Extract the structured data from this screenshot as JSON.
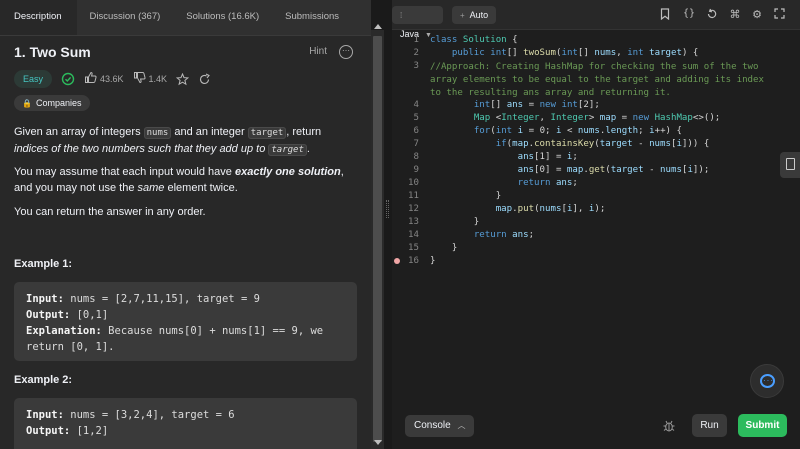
{
  "tabs": [
    {
      "label": "Description",
      "active": true
    },
    {
      "label": "Discussion (367)"
    },
    {
      "label": "Solutions (16.6K)"
    },
    {
      "label": "Submissions"
    }
  ],
  "problem": {
    "title": "1. Two Sum",
    "hint_label": "Hint",
    "difficulty": "Easy",
    "likes": "43.6K",
    "dislikes": "1.4K",
    "companies_label": "Companies"
  },
  "description": {
    "p1_a": "Given an array of integers ",
    "p1_code1": "nums",
    "p1_b": " and an integer ",
    "p1_code2": "target",
    "p1_c": ", return ",
    "p1_it": "indices of the two numbers such that they add up to ",
    "p1_code3": "target",
    "p1_d": ".",
    "p2_a": "You may assume that each input would have ",
    "p2_bi": "exactly one solution",
    "p2_b": ", and you may not use the ",
    "p2_it": "same",
    "p2_c": " element twice.",
    "p3": "You can return the answer in any order."
  },
  "examples": [
    {
      "title": "Example 1:",
      "input_label": "Input:",
      "input": " nums = [2,7,11,15], target = 9",
      "output_label": "Output:",
      "output": " [0,1]",
      "explanation_label": "Explanation:",
      "explanation": " Because nums[0] + nums[1] == 9, we return [0, 1]."
    },
    {
      "title": "Example 2:",
      "input_label": "Input:",
      "input": " nums = [3,2,4], target = 6",
      "output_label": "Output:",
      "output": " [1,2]"
    }
  ],
  "editor": {
    "language": "Java",
    "mode": "Auto",
    "line_numbers": [
      "1",
      "2",
      "3",
      "4",
      "5",
      "6",
      "7",
      "8",
      "9",
      "10",
      "11",
      "12",
      "13",
      "14",
      "15",
      "16"
    ],
    "breakpoint_line": "16"
  },
  "bottom": {
    "console_label": "Console",
    "run_label": "Run",
    "submit_label": "Submit"
  },
  "colors": {
    "accent_green": "#2cbb5d",
    "easy_teal": "#46c6c2",
    "keyword_blue": "#569cd6",
    "type_teal": "#4ec9b0",
    "comment_green": "#6a9955"
  },
  "icons": [
    "lock-icon",
    "thumbs-up-icon",
    "thumbs-down-icon",
    "star-icon",
    "share-icon",
    "check-circle-icon",
    "more-icon",
    "bookmark-icon",
    "braces-icon",
    "reset-icon",
    "command-icon",
    "settings-icon",
    "expand-icon",
    "file-icon",
    "chat-icon",
    "bug-icon"
  ]
}
